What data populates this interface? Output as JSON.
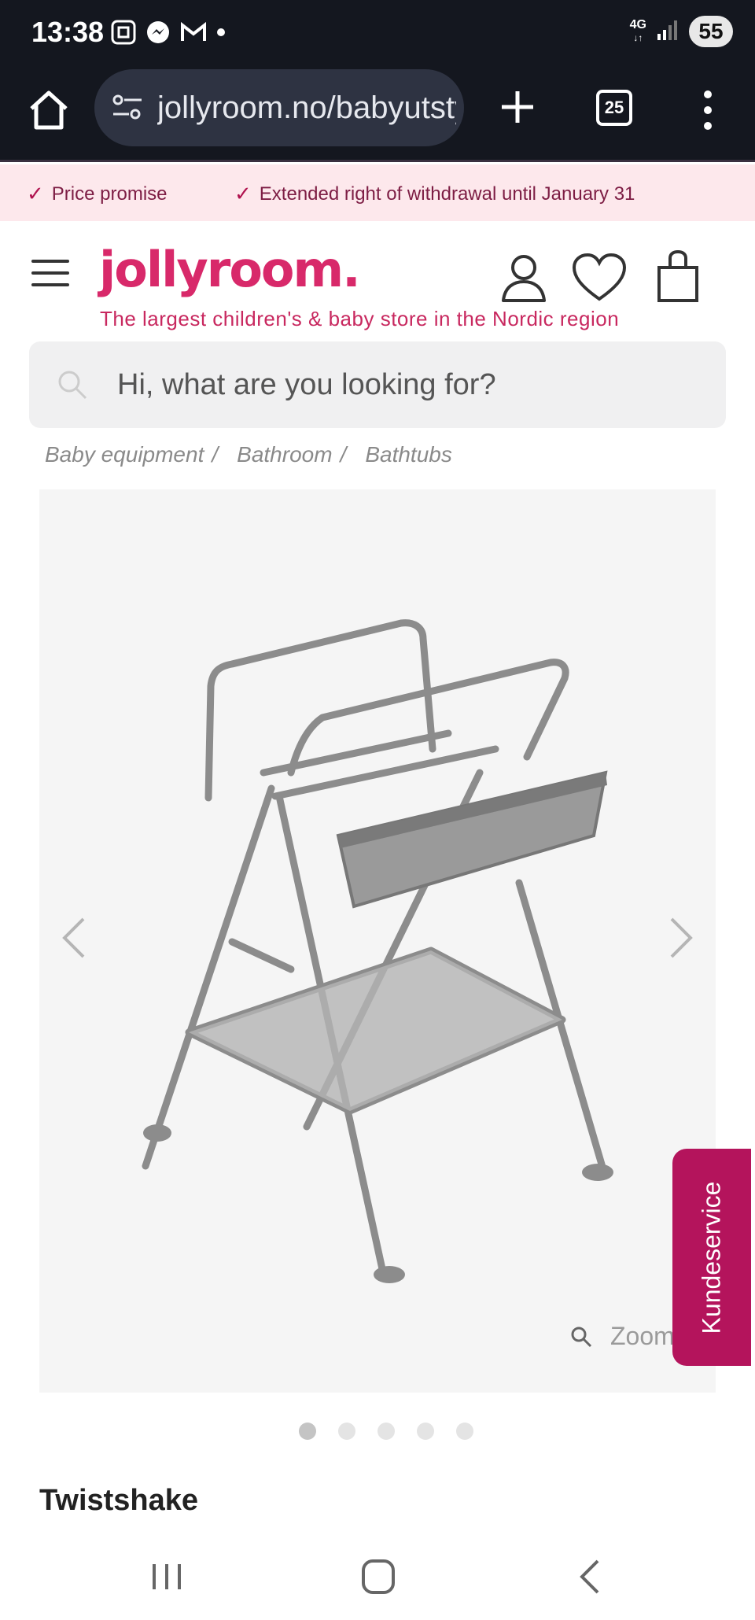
{
  "status_bar": {
    "time": "13:38",
    "network": "4G",
    "battery": "55"
  },
  "browser": {
    "url": "jollyroom.no/babyutstyr/bad/badekar",
    "tab_count": "25"
  },
  "promo": {
    "item1": "Price promise",
    "item2": "Extended right of withdrawal until January 31"
  },
  "header": {
    "logo": "jollyroom.",
    "tagline": "The largest children's & baby store in the Nordic region"
  },
  "search": {
    "placeholder": "Hi, what are you looking for?"
  },
  "breadcrumb": [
    "Baby equipment",
    "Bathroom",
    "Bathtubs"
  ],
  "product": {
    "zoom_label": "Zoom",
    "brand": "Twistshake",
    "image_count": 5,
    "active_image": 1
  },
  "support": {
    "label": "Kundeservice"
  },
  "colors": {
    "brand_pink": "#d8296a",
    "support_bg": "#b4145c",
    "promo_bg": "#fde8ec",
    "status_bg": "#14171f"
  }
}
